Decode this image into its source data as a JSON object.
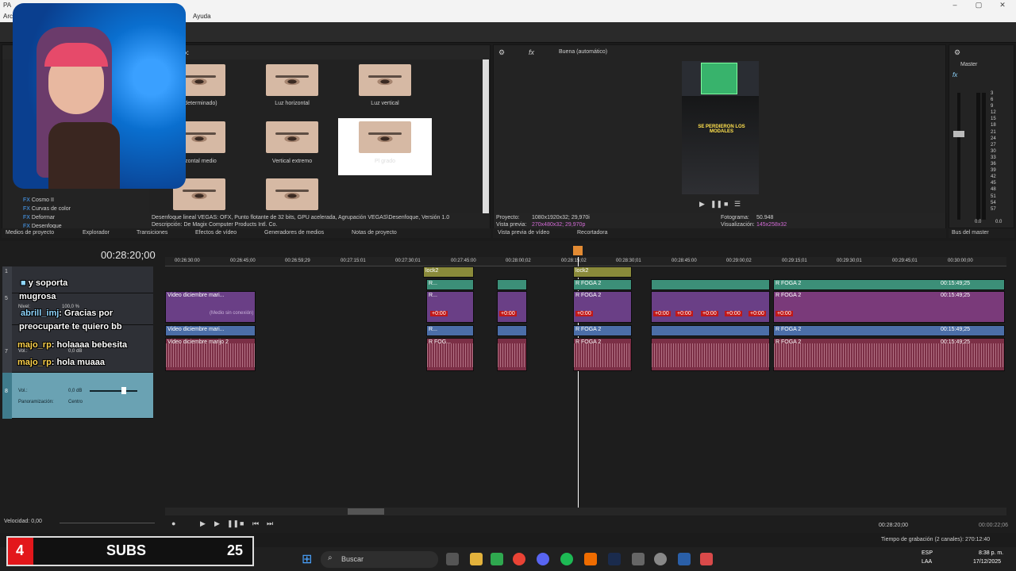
{
  "app": {
    "title_frag": "PA",
    "menu_frag": "Arc",
    "menu_help": "Ayuda"
  },
  "effects_panel": {
    "header": "ado:",
    "items": [
      {
        "label": "determinado)"
      },
      {
        "label": "Luz horizontal"
      },
      {
        "label": "Luz vertical"
      },
      {
        "label": "zontal medio"
      },
      {
        "label": "Vertical extremo"
      },
      {
        "label": "Pl grado"
      }
    ],
    "list": [
      "Cosmo II",
      "Curvas de color",
      "Deformar",
      "Desenfoque"
    ],
    "list_prefix": "FX",
    "description_line1": "Desenfoque lineal VEGAS: OFX, Punto flotante de 32 bits, GPU acelerada, Agrupación VEGAS\\Desenfoque, Versión 1.0",
    "description_line2": "Descripción: De Magix Computer Products Intl. Co.",
    "tabs": [
      "Medios de proyecto",
      "Explorador",
      "Transiciones",
      "Efectos de vídeo",
      "Generadores de medios",
      "Notas de proyecto"
    ]
  },
  "preview": {
    "quality": "Buena (automático)",
    "project_label": "Proyecto:",
    "project_value": "1080x1920x32; 29,970i",
    "preview_label": "Vista previa:",
    "preview_value": "270x480x32; 29,970p",
    "frame_label": "Fotograma:",
    "frame_value": "50.948",
    "display_label": "Visualización:",
    "display_value": "145x258x32",
    "video_caption": "SE PERDIERON LOS MODALES",
    "tabs": [
      "Vista previa de vídeo",
      "Recortadora"
    ]
  },
  "master": {
    "label": "Master",
    "scale": [
      "3",
      "6",
      "9",
      "12",
      "15",
      "18",
      "21",
      "24",
      "27",
      "30",
      "33",
      "36",
      "39",
      "42",
      "45",
      "48",
      "51",
      "54",
      "57"
    ],
    "bottom_left": "0.0",
    "bottom_right": "0.0",
    "tab": "Bus del master"
  },
  "timeline": {
    "timecode": "00:28:20;00",
    "ruler": [
      "00:26:30:00",
      "00:26:45;00",
      "00:26:59;29",
      "00:27:15:01",
      "00:27:30;01",
      "00:27:45:00",
      "00:28:00;02",
      "00:28:15;02",
      "00:28:30;01",
      "00:28:45:00",
      "00:29:00;02",
      "00:29:15;01",
      "00:29:30;01",
      "00:29:45;01",
      "00:30:00;00"
    ],
    "track_nums": [
      "1",
      "3",
      "5",
      "7",
      "8"
    ],
    "level_label": "Nivel:",
    "level_value": "100,0 %",
    "vol_label": "Vol.:",
    "vol_value": "0,0 dB",
    "pan_label": "Panoramización:",
    "pan_value": "Centro",
    "clip_labels": {
      "vid1": "Video diciembre mari...",
      "vid2": "Video diciembre mari...",
      "aud": "Video diciembre marijo 2",
      "offline": "(Medio sin conexión)",
      "rfoga": "R FOGA 2",
      "rfog": "R FOG...",
      "r": "R...",
      "lock": "lock2",
      "time": "00:15:49;25"
    },
    "offset_tag": "+0:00",
    "speed_label": "Velocidad: 0,00",
    "cursor_time": "00:28:20;00",
    "end_time": "00:00:22;06",
    "rec_time": "Tiempo de grabación (2 canales): 270:12:40"
  },
  "chat": [
    {
      "user": "",
      "text": "y soporta"
    },
    {
      "user": "",
      "text": "mugrosa"
    },
    {
      "user": "abrill_imj",
      "text": ": Gracias por"
    },
    {
      "user": "",
      "text": "preocuparte te quiero bb"
    },
    {
      "user": "majo_rp",
      "text": ": holaaaa bebesita"
    },
    {
      "user": "majo_rp",
      "text": ": hola muaaa"
    }
  ],
  "subs": {
    "left": "4",
    "label": "SUBS",
    "right": "25",
    "sub_text": "jado"
  },
  "taskbar": {
    "search": "Buscar",
    "lang": "ESP",
    "lang2": "LAA",
    "time": "8:38 p. m.",
    "date": "17/12/2025"
  },
  "colors": {
    "accent_red": "#c01818",
    "clip_green": "#3c8f78",
    "clip_purple": "#6a3f86",
    "clip_blue": "#4b6ea8",
    "clip_audio": "#7b2f46"
  }
}
